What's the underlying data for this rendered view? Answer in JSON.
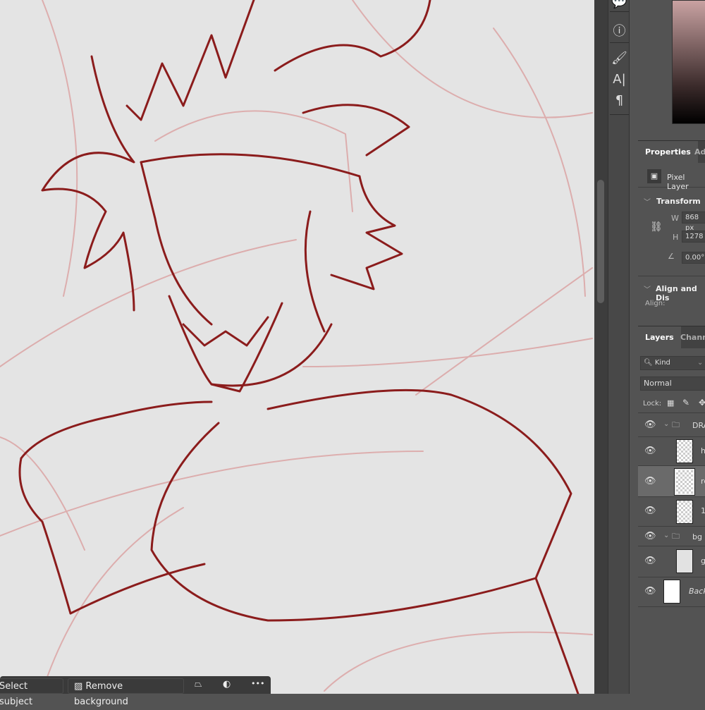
{
  "canvas": {
    "stroke_color": "#8b1c1c",
    "sketch_color": "#d99a9a",
    "background": "#e4e4e4"
  },
  "toolbar_icons": [
    "comment-icon",
    "info-icon",
    "brush-settings-icon",
    "character-icon",
    "paragraph-icon"
  ],
  "properties": {
    "tabs": [
      "Properties",
      "Adj"
    ],
    "layer_type": "Pixel Layer",
    "transform": {
      "title": "Transform",
      "w_label": "W",
      "w_value": "868 px",
      "h_label": "H",
      "h_value": "1278",
      "angle_value": "0.00°"
    },
    "align": {
      "title": "Align and Dis",
      "align_label": "Align:"
    }
  },
  "layers": {
    "tabs": [
      "Layers",
      "Channe"
    ],
    "filter": "Kind",
    "blend_mode": "Normal",
    "lock_label": "Lock:",
    "items": [
      {
        "name": "DRA",
        "type": "group"
      },
      {
        "name": "h",
        "type": "layer"
      },
      {
        "name": "re",
        "type": "layer",
        "selected": true
      },
      {
        "name": "1",
        "type": "layer"
      },
      {
        "name": "bg",
        "type": "group"
      },
      {
        "name": "g",
        "type": "layer"
      },
      {
        "name": "Back",
        "type": "background"
      }
    ]
  },
  "context_bar": {
    "select_subject": "Select subject",
    "remove_background": "Remove background",
    "more": "•••"
  }
}
